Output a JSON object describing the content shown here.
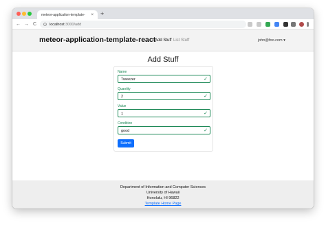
{
  "browser": {
    "tab_title": "meteor-application-template-",
    "tab_close": "×",
    "new_tab": "+",
    "url_host": "localhost",
    "url_path": ":3000/add",
    "back": "←",
    "forward": "→",
    "reload": "C"
  },
  "navbar": {
    "brand": "meteor-application-template-react",
    "links": [
      "Add Stuff",
      "List Stuff"
    ],
    "user": "john@foo.com ▾"
  },
  "page": {
    "title": "Add Stuff",
    "fields": [
      {
        "label": "Name",
        "value": "Tweezer"
      },
      {
        "label": "Quantity",
        "value": "2"
      },
      {
        "label": "Value",
        "value": "1"
      },
      {
        "label": "Condition",
        "value": "good"
      }
    ],
    "check_glyph": "✓",
    "submit": "Submit"
  },
  "footer": {
    "lines": [
      "Department of Information and Computer Sciences",
      "University of Hawaii",
      "Honolulu, HI 96822"
    ],
    "link": "Template Home Page"
  },
  "colors": {
    "valid": "#198754",
    "primary": "#0d6efd"
  }
}
